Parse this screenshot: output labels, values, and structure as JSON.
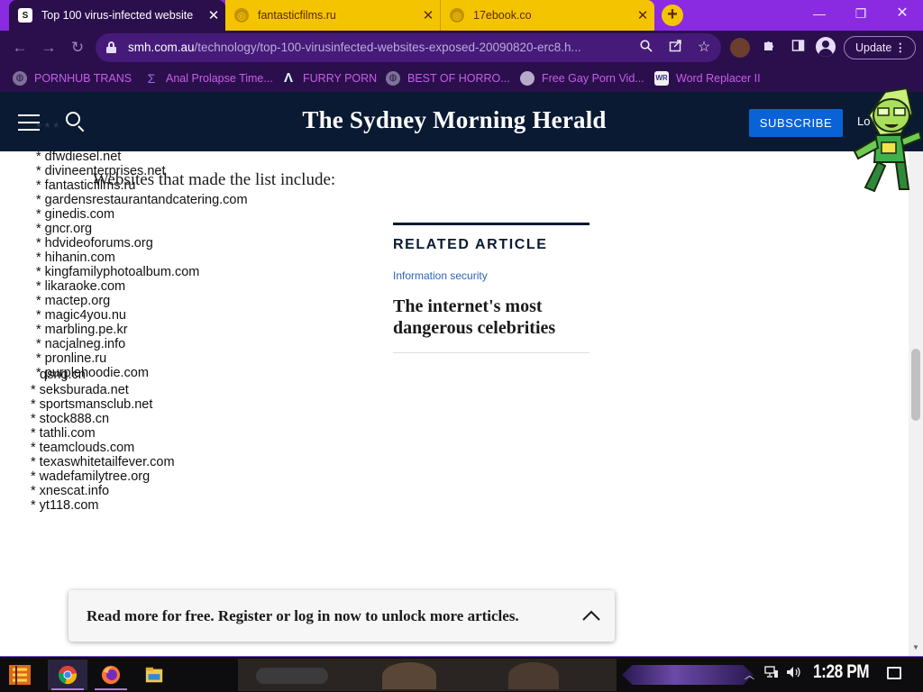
{
  "browser": {
    "tabs": [
      {
        "title": "Top 100 virus-infected website",
        "favicon_letter": "S",
        "active": true
      },
      {
        "title": "fantasticfilms.ru",
        "favicon_letter": "◎",
        "active": false
      },
      {
        "title": "17ebook.co",
        "favicon_letter": "◎",
        "active": false
      }
    ],
    "new_tab_label": "+",
    "close_glyph": "✕",
    "window_controls": {
      "minimize": "—",
      "restore": "❐",
      "close": "✕"
    },
    "address": {
      "host": "smh.com.au",
      "path": "/technology/top-100-virusinfected-websites-exposed-20090820-erc8.h..."
    },
    "update_label": "Update",
    "menu_glyph": "⋮",
    "colors": {
      "tab_bar": "#8a2be2",
      "toolbar": "#2b0f4d",
      "inactive_tab": "#f5c400",
      "bookmark_text": "#c75ee8"
    }
  },
  "bookmarks": [
    {
      "label": "PORNHUB TRANS",
      "icon": "globe-icon"
    },
    {
      "label": "Anal Prolapse Time...",
      "icon": "square-bracket-icon"
    },
    {
      "label": "FURRY PORN",
      "icon": "triangle-logo-icon"
    },
    {
      "label": "BEST OF HORRO...",
      "icon": "globe-icon"
    },
    {
      "label": "Free Gay Porn Vid...",
      "icon": "owl-icon"
    },
    {
      "label": "Word Replacer II",
      "icon": "wr-icon",
      "icon_text": "WR"
    }
  ],
  "site": {
    "masthead": "The Sydney Morning Herald",
    "subscribe_label": "SUBSCRIBE",
    "login_label": "Lo",
    "brand_color": "#0a1a33",
    "accent_color": "#0a63d6"
  },
  "article": {
    "leadin": "Websites that made the list include:",
    "list_top": [
      "* dfwdiesel.net",
      "* divineenterprises.net",
      "* fantasticfilms.ru",
      "* gardensrestaurantandcatering.com",
      "* ginedis.com",
      "* gncr.org",
      "* hdvideoforums.org",
      "* hihanin.com",
      "* kingfamilyphotoalbum.com",
      "* likaraoke.com",
      "* mactep.org",
      "* magic4you.nu",
      "* marbling.pe.kr",
      "* nacjalneg.info",
      "* pronline.ru",
      "* purplehoodie.com"
    ],
    "overlap_item": "qsng.cn",
    "list_bottom": [
      "* seksburada.net",
      "* sportsmansclub.net",
      "* stock888.cn",
      "* tathli.com",
      "* teamclouds.com",
      "* texaswhitetailfever.com",
      "* wadefamilytree.org",
      "* xnescat.info",
      "* yt118.com"
    ]
  },
  "related": {
    "kicker": "RELATED ARTICLE",
    "category": "Information security",
    "headline": "The internet's most dangerous celebrities"
  },
  "register_bar": {
    "message": "Read more for free. Register or log in now to unlock more articles."
  },
  "taskbar": {
    "apps": [
      "chrome-icon",
      "firefox-icon",
      "file-explorer-icon"
    ],
    "clock": "1:28 PM",
    "tray": [
      "chevron-up-icon",
      "network-icon",
      "volume-icon"
    ]
  }
}
